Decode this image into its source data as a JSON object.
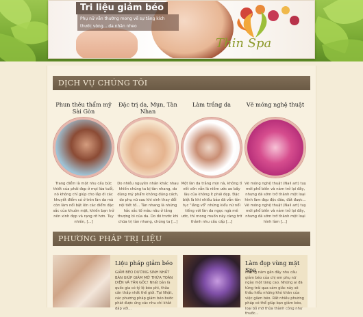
{
  "header": {
    "banner_title": "Tri liệu giảm béo",
    "banner_subtitle": "Phụ nữ vẫn thường mong về sự tăng kích thước vòng... da nhăn nheo",
    "logo_text": "Thin Spa"
  },
  "section1": {
    "title": "DỊCH VỤ CHÚNG TÔI",
    "services": [
      {
        "title": "Phun thêu thẩm mỹ Sài Gòn",
        "desc": "Trang điểm là một nhu cầu bức thiết của phái đẹp ở mọi lứa tuổi, nó không chỉ giúp cho lắp đi các khuyết điểm có ở trên làn da mà còn làm nổi bật lên các điểm đặc sắc của khuôn mặt, khiến bạn trở nên xinh đẹp và rạng rỡ hơn. Tuy nhiên, [...]"
      },
      {
        "title": "Đặc trị da, Mụn, Tàn Nhan",
        "desc": "Do nhiều nguyên nhân khác nhau khiến chúng ta bị tàn nhang, do dùng mỹ phẩm không đúng cách, do phụ nữ sau khi sinh thay đổi nội tiết tố... Tàn nhang là những hắc sắc tố màu nâu ở tầng thượng bì của da. Do đó trước khi chữa trị tàn nhang, chúng ta [...]"
      },
      {
        "title": "Làm trắng da",
        "desc": "Một làn da trắng mịn nà, không tì vết vốn vẫn là niềm ước ao bấy lâu của không ít phái đẹp. Đặc biệt là khi nhiều bảo đã vẫn tôn tục \"lắng vổ\" những kiểu nữ nổi tiếng với làn da ngọc ngà mê ước, thì mong muốn này càng trở thành nhu cầu cấp [...]"
      },
      {
        "title": "Vẽ móng nghệ thuật",
        "desc": "Vẽ móng nghệ thuật (Nail art) tuy mới phổ biến và nảm trở lại đây, nhưng đã sớm trở thành một loại hình làm đẹp độc đáo, đắt được... Vẽ móng nghệ thuật (Nail art) tuy mới phổ biến và nảm trở lại đây, nhưng đã sớm trở thành một loại hình làm [...]"
      }
    ]
  },
  "section2": {
    "title": "PHƯƠNG PHÁP TRỊ LIỆU",
    "methods": [
      {
        "title": "Liệu pháp giảm béo",
        "desc": "GIẢM BÉO DƯỠNG SINH NHẤT BẢN GIÚP GIẢM MỠ THỪA TOÀN DIỆN VÀ TĂN GỐC! Nhất bản là quốc gia có tỷ lệ béo phì, thừa cân thấp nhất thế giới. Tại Nhật, các phương pháp giảm béo bước phát được ứng các nhu chỉ khắt đáp với..."
      },
      {
        "title": "Làm đẹp vùng mặt Spa",
        "desc": "Những năm gần đây nhu cầu giảm béo của chị em phụ nữ ngày một tăng cao. Những ai đã từng trải qua cảm giác này sẽ thấu hiểu những khó khăn của việc giảm béo. Rất nhiều phương pháp có thể giúp bạn giảm béo, loại bỏ mỡ thừa thành công như thuốc..."
      }
    ]
  },
  "colors": {
    "section_bar": "#6b5a45",
    "circle_border": "#e6b7ad",
    "page_bg": "#f4ecd7",
    "header_green": "#7eae37"
  }
}
